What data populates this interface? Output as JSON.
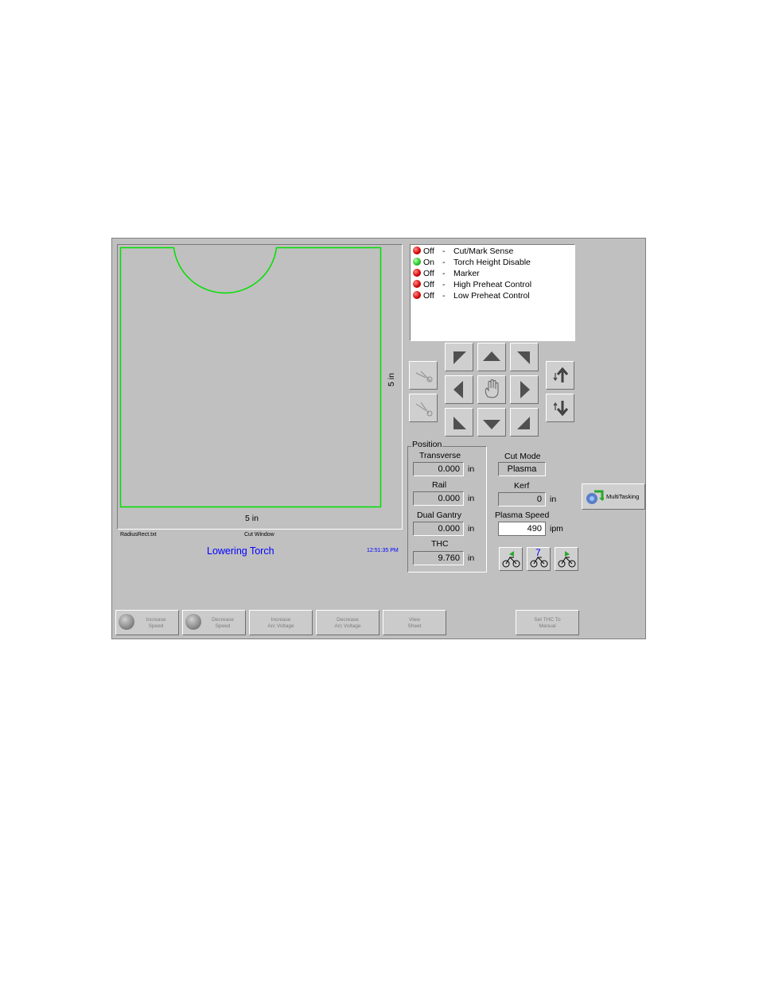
{
  "canvas": {
    "dim_right": "5 in",
    "dim_bottom": "5 in",
    "file_name": "RadiusRect.txt",
    "window_label": "Cut Window",
    "status_message": "Lowering Torch",
    "clock": "12:51:35 PM"
  },
  "status_list": [
    {
      "state": "Off",
      "led": "red",
      "sep": "-",
      "label": "Cut/Mark Sense"
    },
    {
      "state": "On",
      "led": "green",
      "sep": "-",
      "label": "Torch Height Disable"
    },
    {
      "state": "Off",
      "led": "red",
      "sep": "-",
      "label": "Marker"
    },
    {
      "state": "Off",
      "led": "red",
      "sep": "-",
      "label": "High Preheat Control"
    },
    {
      "state": "Off",
      "led": "red",
      "sep": "-",
      "label": "Low Preheat Control"
    }
  ],
  "position": {
    "group_label": "Position",
    "transverse": {
      "label": "Transverse",
      "value": "0.000",
      "unit": "in"
    },
    "rail": {
      "label": "Rail",
      "value": "0.000",
      "unit": "in"
    },
    "dual_gantry": {
      "label": "Dual Gantry",
      "value": "0.000",
      "unit": "in"
    },
    "thc": {
      "label": "THC",
      "value": "9.760",
      "unit": "in"
    }
  },
  "cut_mode": {
    "label": "Cut Mode",
    "value": "Plasma"
  },
  "kerf": {
    "label": "Kerf",
    "value": "0",
    "unit": "in"
  },
  "plasma_speed": {
    "label": "Plasma Speed",
    "value": "490",
    "unit": "ipm"
  },
  "multitasking": {
    "label": "MultiTasking"
  },
  "bike_buttons": {
    "middle_digit": "7"
  },
  "softkeys": {
    "increase_speed": {
      "line1": "Increase",
      "line2": "Speed"
    },
    "decrease_speed": {
      "line1": "Decrease",
      "line2": "Speed"
    },
    "increase_arc_voltage": {
      "line1": "Increase",
      "line2": "Arc Voltage"
    },
    "decrease_arc_voltage": {
      "line1": "Decrease",
      "line2": "Arc Voltage"
    },
    "view_sheet": {
      "line1": "View",
      "line2": "Sheet"
    },
    "set_thc_manual": {
      "line1": "Set THC To",
      "line2": "Manual"
    }
  },
  "colors": {
    "panel": "#c0c0c0",
    "part_outline": "#00e000",
    "status_text": "#0000ff"
  }
}
